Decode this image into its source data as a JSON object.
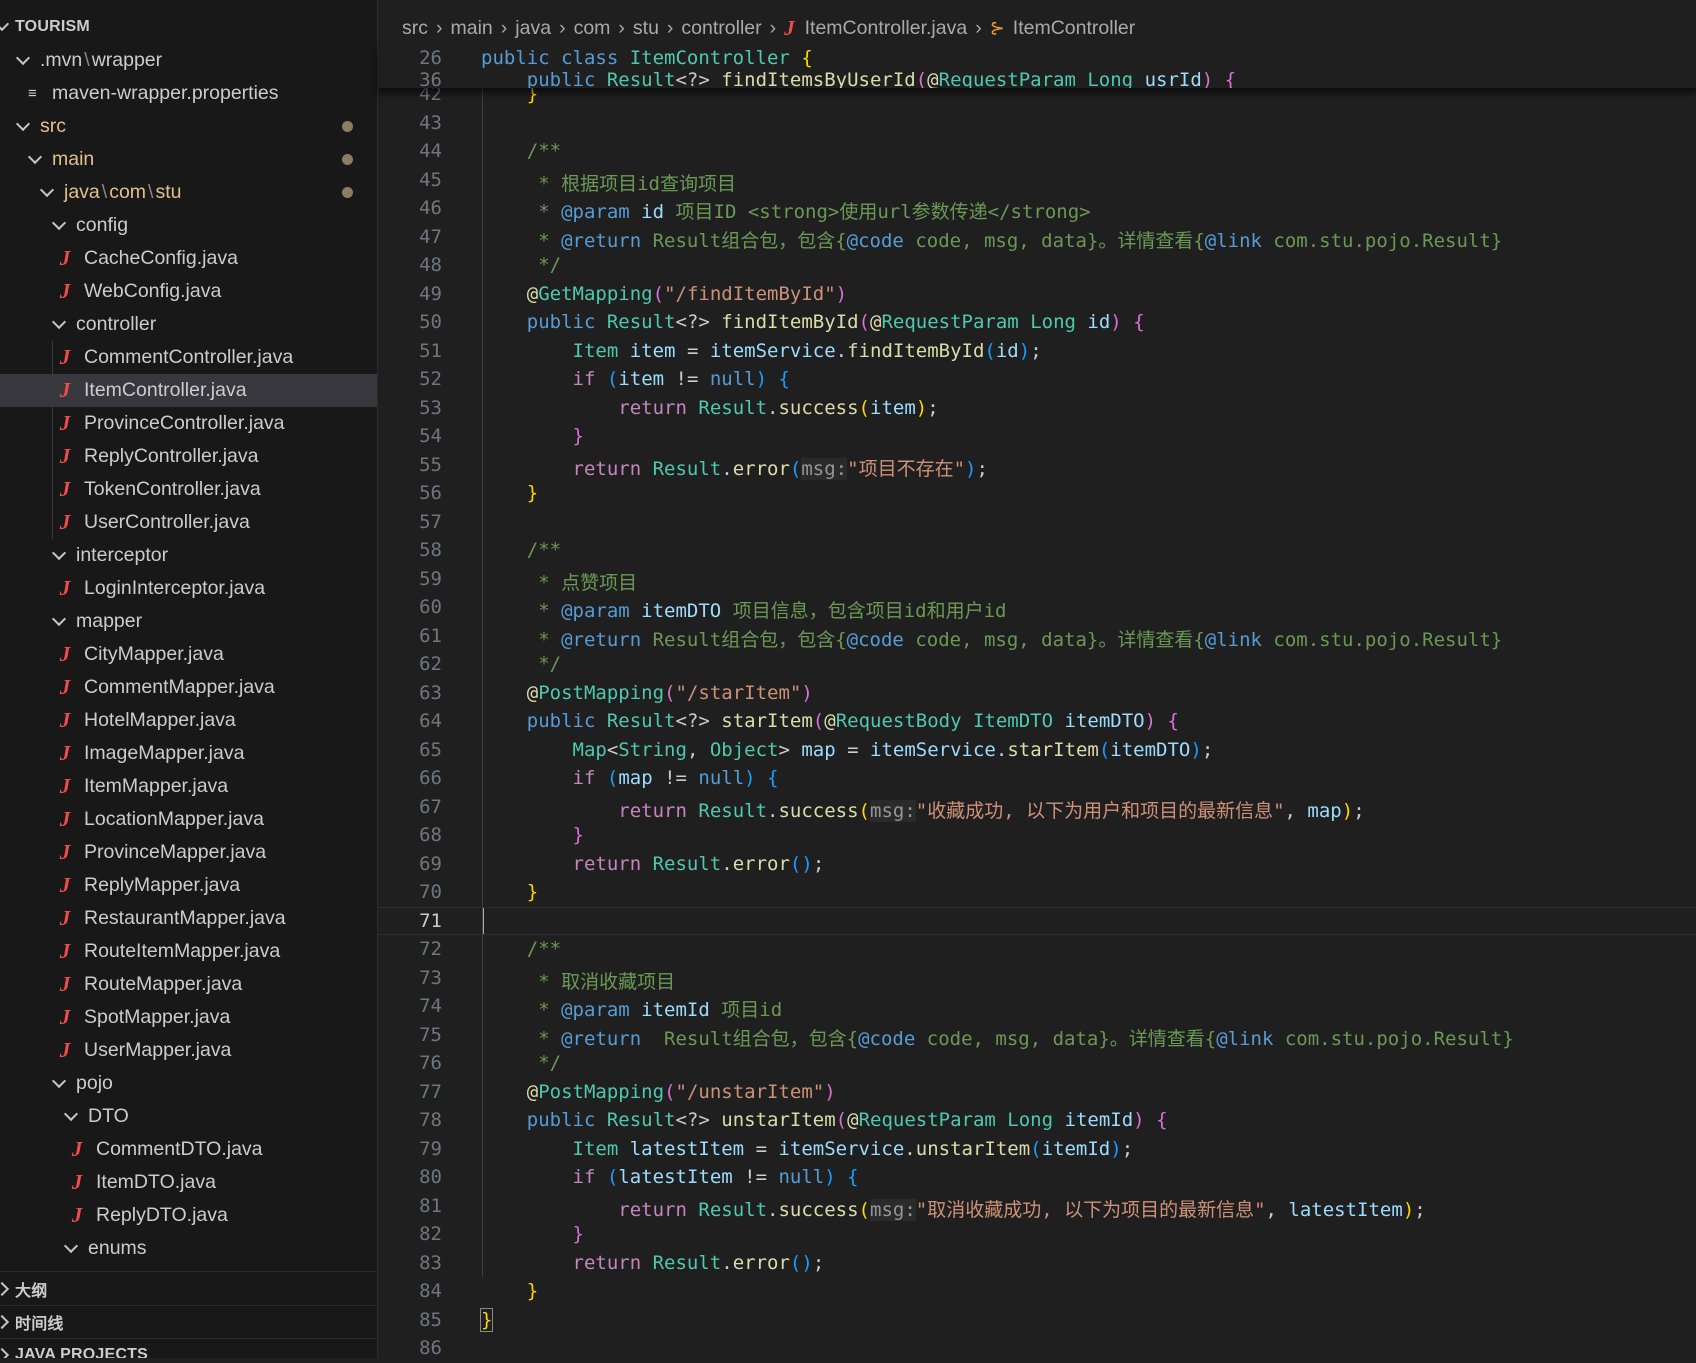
{
  "sidebar": {
    "header": "TOURISM",
    "items": [
      {
        "label": "",
        "parts": [
          ".mvn",
          "wrapper"
        ]
      },
      {
        "label": "maven-wrapper.properties"
      },
      {
        "label": "src"
      },
      {
        "label": "main"
      },
      {
        "label": "",
        "parts": [
          "java",
          "com",
          "stu"
        ]
      },
      {
        "label": "config"
      },
      {
        "label": "CacheConfig.java"
      },
      {
        "label": "WebConfig.java"
      },
      {
        "label": "controller"
      },
      {
        "label": "CommentController.java"
      },
      {
        "label": "ItemController.java"
      },
      {
        "label": "ProvinceController.java"
      },
      {
        "label": "ReplyController.java"
      },
      {
        "label": "TokenController.java"
      },
      {
        "label": "UserController.java"
      },
      {
        "label": "interceptor"
      },
      {
        "label": "LoginInterceptor.java"
      },
      {
        "label": "mapper"
      },
      {
        "label": "CityMapper.java"
      },
      {
        "label": "CommentMapper.java"
      },
      {
        "label": "HotelMapper.java"
      },
      {
        "label": "ImageMapper.java"
      },
      {
        "label": "ItemMapper.java"
      },
      {
        "label": "LocationMapper.java"
      },
      {
        "label": "ProvinceMapper.java"
      },
      {
        "label": "ReplyMapper.java"
      },
      {
        "label": "RestaurantMapper.java"
      },
      {
        "label": "RouteItemMapper.java"
      },
      {
        "label": "RouteMapper.java"
      },
      {
        "label": "SpotMapper.java"
      },
      {
        "label": "UserMapper.java"
      },
      {
        "label": "pojo"
      },
      {
        "label": "DTO"
      },
      {
        "label": "CommentDTO.java"
      },
      {
        "label": "ItemDTO.java"
      },
      {
        "label": "ReplyDTO.java"
      },
      {
        "label": "enums"
      }
    ],
    "sections": [
      "大纲",
      "时间线",
      "JAVA PROJECTS"
    ]
  },
  "breadcrumb": {
    "parts": [
      "src",
      "main",
      "java",
      "com",
      "stu",
      "controller"
    ],
    "file": "ItemController.java",
    "symbol": "ItemController"
  },
  "editor": {
    "sticky_line_number": "26",
    "sticky_partial_number": "36",
    "sticky_partial_text": "    public Result<?> findItemsByUserId(@RequestParam Long usrId) {",
    "active_line": "71",
    "lines": [
      {
        "n": "26",
        "text": "public class ItemController {"
      },
      {
        "n": "42",
        "text": "    }"
      },
      {
        "n": "43",
        "text": ""
      },
      {
        "n": "44",
        "text": "    /**"
      },
      {
        "n": "45",
        "text": "     * 根据项目id查询项目"
      },
      {
        "n": "46",
        "text": "     * @param id 项目ID <strong>使用url参数传递</strong>"
      },
      {
        "n": "47",
        "text": "     * @return Result组合包，包含{@code code, msg, data}。详情查看{@link com.stu.pojo.Result}"
      },
      {
        "n": "48",
        "text": "     */"
      },
      {
        "n": "49",
        "text": "    @GetMapping(\"/findItemById\")"
      },
      {
        "n": "50",
        "text": "    public Result<?> findItemById(@RequestParam Long id) {"
      },
      {
        "n": "51",
        "text": "        Item item = itemService.findItemById(id);"
      },
      {
        "n": "52",
        "text": "        if (item != null) {"
      },
      {
        "n": "53",
        "text": "            return Result.success(item);"
      },
      {
        "n": "54",
        "text": "        }"
      },
      {
        "n": "55",
        "text": "        return Result.error(msg:\"项目不存在\");"
      },
      {
        "n": "56",
        "text": "    }"
      },
      {
        "n": "57",
        "text": ""
      },
      {
        "n": "58",
        "text": "    /**"
      },
      {
        "n": "59",
        "text": "     * 点赞项目"
      },
      {
        "n": "60",
        "text": "     * @param itemDTO 项目信息，包含项目id和用户id"
      },
      {
        "n": "61",
        "text": "     * @return Result组合包，包含{@code code, msg, data}。详情查看{@link com.stu.pojo.Result}"
      },
      {
        "n": "62",
        "text": "     */"
      },
      {
        "n": "63",
        "text": "    @PostMapping(\"/starItem\")"
      },
      {
        "n": "64",
        "text": "    public Result<?> starItem(@RequestBody ItemDTO itemDTO) {"
      },
      {
        "n": "65",
        "text": "        Map<String, Object> map = itemService.starItem(itemDTO);"
      },
      {
        "n": "66",
        "text": "        if (map != null) {"
      },
      {
        "n": "67",
        "text": "            return Result.success(msg:\"收藏成功, 以下为用户和项目的最新信息\", map);"
      },
      {
        "n": "68",
        "text": "        }"
      },
      {
        "n": "69",
        "text": "        return Result.error();"
      },
      {
        "n": "70",
        "text": "    }"
      },
      {
        "n": "71",
        "text": ""
      },
      {
        "n": "72",
        "text": "    /**"
      },
      {
        "n": "73",
        "text": "     * 取消收藏项目"
      },
      {
        "n": "74",
        "text": "     * @param itemId 项目id"
      },
      {
        "n": "75",
        "text": "     * @return  Result组合包，包含{@code code, msg, data}。详情查看{@link com.stu.pojo.Result}"
      },
      {
        "n": "76",
        "text": "     */"
      },
      {
        "n": "77",
        "text": "    @PostMapping(\"/unstarItem\")"
      },
      {
        "n": "78",
        "text": "    public Result<?> unstarItem(@RequestParam Long itemId) {"
      },
      {
        "n": "79",
        "text": "        Item latestItem = itemService.unstarItem(itemId);"
      },
      {
        "n": "80",
        "text": "        if (latestItem != null) {"
      },
      {
        "n": "81",
        "text": "            return Result.success(msg:\"取消收藏成功, 以下为项目的最新信息\", latestItem);"
      },
      {
        "n": "82",
        "text": "        }"
      },
      {
        "n": "83",
        "text": "        return Result.error();"
      },
      {
        "n": "84",
        "text": "    }"
      },
      {
        "n": "85",
        "text": "}"
      },
      {
        "n": "86",
        "text": ""
      }
    ]
  },
  "colors": {
    "keyword": "#569cd6",
    "control": "#c586c0",
    "type": "#4ec9b0",
    "function": "#dcdcaa",
    "variable": "#9cdcfe",
    "string": "#ce9178",
    "comment": "#6a9955",
    "java_icon": "#f14c4c"
  }
}
